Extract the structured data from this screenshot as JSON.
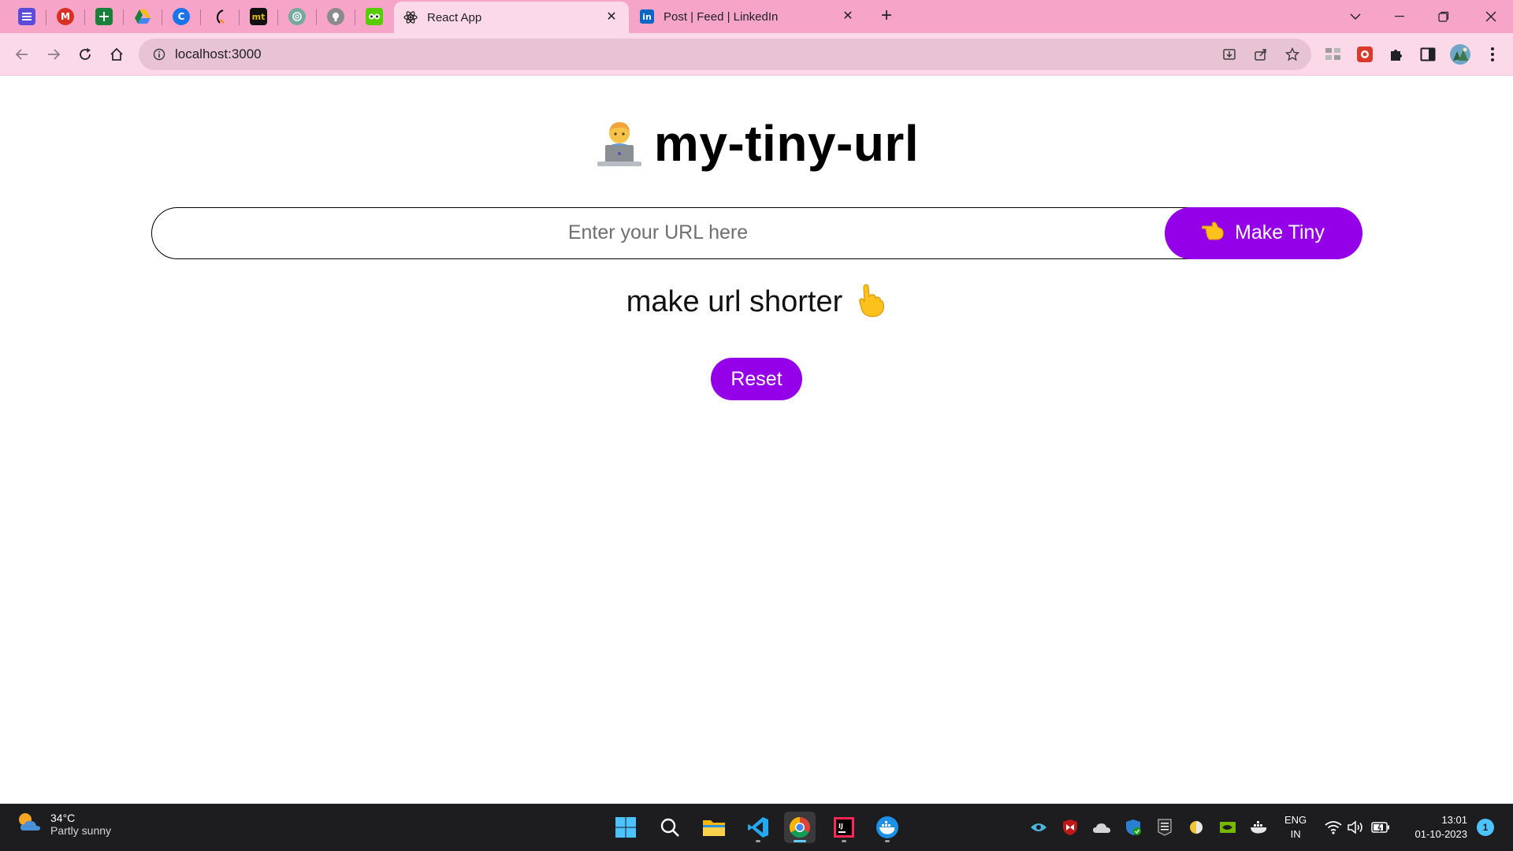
{
  "browser": {
    "pinned_tabs": [
      {
        "icon": "google-tasks-icon"
      },
      {
        "icon": "gmail-icon"
      },
      {
        "icon": "google-sheets-icon"
      },
      {
        "icon": "google-drive-icon"
      },
      {
        "icon": "c-app-icon"
      },
      {
        "icon": "hashnode-icon"
      },
      {
        "icon": "monkeytype-icon"
      },
      {
        "icon": "chatgpt-icon"
      },
      {
        "icon": "github-icon"
      },
      {
        "icon": "duolingo-icon"
      }
    ],
    "tabs": [
      {
        "title": "React App",
        "icon": "react-icon",
        "active": true
      },
      {
        "title": "Post | Feed | LinkedIn",
        "icon": "linkedin-icon",
        "active": false
      }
    ],
    "close_glyph": "✕",
    "new_tab_glyph": "+",
    "address": "localhost:3000",
    "accent_color": "#f6a5c9"
  },
  "app": {
    "title": "my-tiny-url",
    "title_emoji": "technologist-emoji",
    "url_placeholder": "Enter your URL here",
    "url_value": "",
    "make_button_label": "Make Tiny",
    "make_button_emoji": "pointing-left-emoji",
    "tagline": "make url shorter",
    "tagline_emoji": "pointing-up-emoji",
    "reset_label": "Reset",
    "accent_color": "#9400e8"
  },
  "taskbar": {
    "weather_temp": "34°C",
    "weather_desc": "Partly sunny",
    "lang_line1": "ENG",
    "lang_line2": "IN",
    "time": "13:01",
    "date": "01-10-2023",
    "notification_count": "1",
    "apps": [
      "windows-start-icon",
      "search-icon",
      "file-explorer-icon",
      "vscode-icon",
      "chrome-icon",
      "intellij-icon",
      "docker-icon"
    ]
  }
}
